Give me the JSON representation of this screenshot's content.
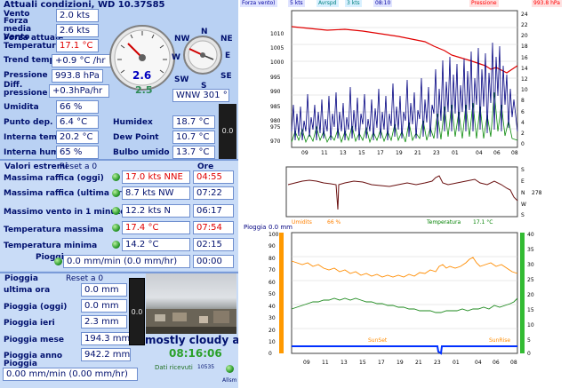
{
  "current": {
    "title": "Attuali condizioni, WD 10.37S85",
    "rows": [
      {
        "label": "Vento",
        "value": "2.0 kts"
      },
      {
        "label": "Forza media Vento",
        "value": "2.6 kts"
      },
      {
        "label": "Forza attuale",
        "value": ""
      },
      {
        "label": "Temperatura",
        "value": "17.1 °C"
      },
      {
        "label": "Trend temp",
        "value": "+0.9 °C /hr"
      },
      {
        "label": "Pressione",
        "value": "993.8 hPa"
      },
      {
        "label": "Diff. pressione",
        "value": "+0.3hPa/hr"
      },
      {
        "label": "Umidita",
        "value": "66 %"
      },
      {
        "label": "Punto dep.",
        "value": "6.4 °C"
      },
      {
        "label": "Interna temp.",
        "value": "20.2 °C"
      },
      {
        "label": "Interna hum",
        "value": "65 %"
      }
    ],
    "humidex_label": "Humidex",
    "humidex_value": "18.7 °C",
    "dewpoint_label": "Dew Point",
    "dewpoint_value": "10.7 °C",
    "wetbulb_label": "Bulbo umido",
    "wetbulb_value": "13.7 °C",
    "speed_gauge_value": "2.6",
    "speed_gauge_sub": "2.5",
    "compass_labels": {
      "n": "N",
      "ne": "NE",
      "e": "E",
      "se": "SE",
      "s": "S",
      "sw": "SW",
      "w": "W",
      "nw": "NW"
    },
    "direction_value": "WNW 301 °",
    "side_value": "0.0"
  },
  "extremes": {
    "title": "Valori estremi",
    "reset": "Reset a 0",
    "ore_label": "Ore",
    "rows": [
      {
        "label": "Massima raffica (oggi)",
        "value": "17.0 kts NNE",
        "time": "04:55",
        "red": true
      },
      {
        "label": "Massima raffica (ultima ora)",
        "value": "8.7 kts  NW",
        "time": "07:22",
        "red": false
      },
      {
        "label": "Massimo vento in 1 minuto",
        "value": "12.2 kts   N",
        "time": "06:17",
        "red": false
      },
      {
        "label": "Temperatura massima",
        "value": "17.4 °C",
        "time": "07:54",
        "red": true
      },
      {
        "label": "Temperatura minima",
        "value": "14.2 °C",
        "time": "02:15",
        "red": false
      },
      {
        "label": "Pioggia max",
        "value": "0.0 mm/min (0.0 mm/hr)",
        "time": "00:00",
        "red": false
      }
    ]
  },
  "rain": {
    "title": "Pioggia",
    "reset": "Reset a 0",
    "rows": [
      {
        "label": "ultima ora",
        "value": "0.0 mm"
      },
      {
        "label": "Pioggia (oggi)",
        "value": "0.0 mm"
      },
      {
        "label": "Pioggia ieri",
        "value": "2.3 mm"
      },
      {
        "label": "Pioggia mese",
        "value": "194.3 mm"
      },
      {
        "label": "Pioggia anno",
        "value": "942.2 mm"
      }
    ],
    "rate_label": "Pioggia",
    "rate_value": "0.00 mm/min (0.00 mm/hr)",
    "side_value": "0.0",
    "condition": "mostly cloudy an",
    "clock": "08:16:06",
    "data_label": "Dati ricevuti",
    "data_count": "10535",
    "alarm_label": "Allsm"
  },
  "charts": {
    "top_legend": [
      {
        "label": "Forza vento)",
        "color": "#0000a0"
      },
      {
        "label": "5 kts",
        "color": "#0000a0"
      },
      {
        "label": "Avrspd",
        "color": "#008080"
      },
      {
        "label": "3 kts",
        "color": "#008080"
      },
      {
        "label": "08:10",
        "color": "#0000a0"
      },
      {
        "label": "Pressione",
        "color": "#ff0000"
      },
      {
        "label": "993.8 hPa",
        "color": "#ff0000"
      }
    ],
    "top_left_ticks": [
      "1010",
      "1005",
      "1000",
      "995",
      "990",
      "985",
      "980",
      "975",
      "970"
    ],
    "top_right_ticks": [
      "24",
      "22",
      "20",
      "18",
      "16",
      "14",
      "12",
      "10",
      "8",
      "6",
      "4",
      "2",
      "0"
    ],
    "time_ticks": [
      "09",
      "11",
      "13",
      "15",
      "17",
      "19",
      "21",
      "23",
      "01",
      "04",
      "06",
      "08"
    ],
    "dir_ticks": [
      "S",
      "E",
      "N",
      "W",
      "S"
    ],
    "dir_value": "278",
    "bottom_legend": [
      {
        "label": "Pioggia",
        "color": "#000080"
      },
      {
        "label": "0.0 mm",
        "color": "#000080"
      },
      {
        "label": "Umidits",
        "color": "#ff8000"
      },
      {
        "label": "66 %",
        "color": "#ff8000"
      },
      {
        "label": "Temperatura",
        "color": "#008000"
      },
      {
        "label": "17.1 °C",
        "color": "#008000"
      }
    ],
    "bottom_left_ticks": [
      "100",
      "90",
      "80",
      "70",
      "60",
      "50",
      "40",
      "30",
      "20",
      "10",
      "0"
    ],
    "bottom_right_ticks": [
      "40",
      "35",
      "30",
      "25",
      "20",
      "15",
      "10",
      "5",
      "0"
    ],
    "sunset_label": "SunSet",
    "sunrise_label": "SunRise"
  }
}
